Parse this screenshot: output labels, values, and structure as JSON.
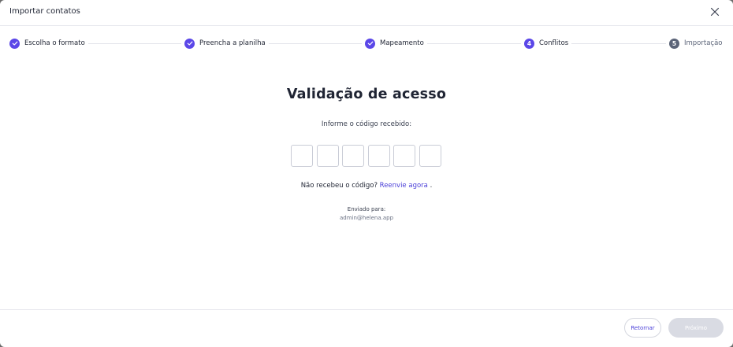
{
  "dialog": {
    "title": "Importar contatos"
  },
  "stepper": {
    "steps": [
      {
        "label": "Escolha o formato",
        "state": "done",
        "marker": ""
      },
      {
        "label": "Preencha a planilha",
        "state": "done",
        "marker": ""
      },
      {
        "label": "Mapeamento",
        "state": "done",
        "marker": ""
      },
      {
        "label": "Conflitos",
        "state": "active",
        "marker": "4"
      },
      {
        "label": "Importação",
        "state": "pending",
        "marker": "5"
      }
    ]
  },
  "content": {
    "heading": "Validação de acesso",
    "instruction": "Informe o código recebido:",
    "code_values": [
      "",
      "",
      "",
      "",
      "",
      ""
    ],
    "resend_text": "Não recebeu o código?",
    "resend_link": "Reenvie agora",
    "resend_suffix": " .",
    "sent_label": "Enviado para:",
    "sent_email": "admin@helena.app"
  },
  "footer": {
    "back_label": "Retornar",
    "next_label": "Próximo"
  },
  "colors": {
    "accent": "#5b47e8",
    "pending": "#5b6478",
    "disabled_button": "#d9dbe3"
  }
}
